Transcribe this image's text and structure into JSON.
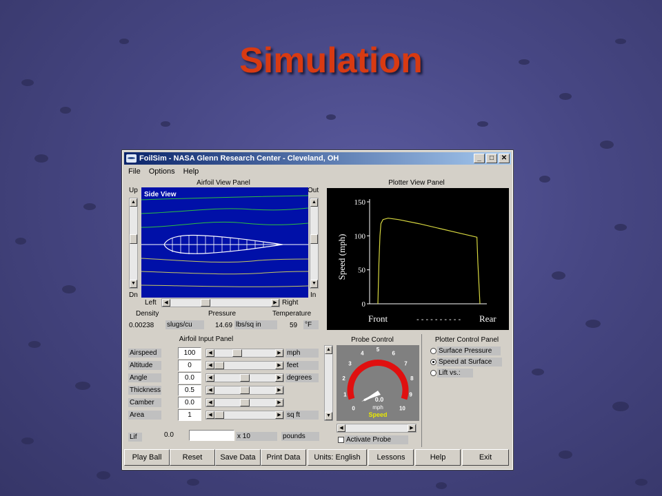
{
  "slide": {
    "title": "Simulation"
  },
  "window": {
    "title": "FoilSim - NASA Glenn Research Center - Cleveland, OH",
    "controls": {
      "minimize": "_",
      "maximize": "□",
      "close": "✕"
    },
    "menu": [
      "File",
      "Options",
      "Help"
    ]
  },
  "airfoil_view": {
    "title": "Airfoil View Panel",
    "side_view": "Side View",
    "up": "Up",
    "dn": "Dn",
    "out": "Out",
    "in": "In",
    "left": "Left",
    "right": "Right",
    "density_label": "Density",
    "pressure_label": "Pressure",
    "temperature_label": "Temperature",
    "density_value": "0.00238",
    "density_unit": "slugs/cu",
    "pressure_value": "14.69",
    "pressure_unit": "lbs/sq in",
    "temperature_value": "59",
    "temperature_unit": "°F",
    "colors": {
      "background": "#0010a8",
      "airfoil": "#ffffff",
      "upper_stream": "#2fbf3f",
      "lower_stream": "#c8c860"
    }
  },
  "airfoil_input": {
    "title": "Airfoil Input Panel",
    "rows": [
      {
        "label": "Airspeed",
        "value": "100",
        "unit": "mph",
        "slider": 0.35
      },
      {
        "label": "Altitude",
        "value": "0",
        "unit": "feet",
        "slider": 0.0
      },
      {
        "label": "Angle",
        "value": "0.0",
        "unit": "degrees",
        "slider": 0.5
      },
      {
        "label": "Thickness",
        "value": "0.5",
        "unit": "",
        "slider": 0.5
      },
      {
        "label": "Camber",
        "value": "0.0",
        "unit": "",
        "slider": 0.5
      },
      {
        "label": "Area",
        "value": "1",
        "unit": "sq ft",
        "slider": 0.0
      }
    ],
    "lift_label": "Lif",
    "lift_value": "0.0",
    "lift_multiplier": "x 10",
    "lift_unit": "pounds"
  },
  "plotter_view": {
    "title": "Plotter View Panel",
    "ylabel": "Speed (mph)",
    "xlabel_front": "Front",
    "xlabel_dashes": "- - - - - - - - - -",
    "xlabel_rear": "Rear"
  },
  "chart_data": {
    "type": "line",
    "title": "",
    "ylabel": "Speed (mph)",
    "xlabel": "Front - - - - - - - - - - Rear",
    "ylim": [
      0,
      150
    ],
    "yticks": [
      "0",
      "50",
      "100",
      "150"
    ],
    "x": [
      0,
      1,
      2,
      3,
      5,
      10,
      20,
      40,
      60,
      80,
      97,
      98,
      100
    ],
    "series": [
      {
        "values": [
          0,
          60,
          100,
          118,
          124,
          126,
          124,
          118,
          111,
          104,
          98,
          60,
          0
        ]
      }
    ],
    "colors": {
      "background": "#000000",
      "axis": "#ffffff",
      "line": "#d8d840"
    }
  },
  "probe_control": {
    "title": "Probe Control",
    "gauge_ticks": [
      "0",
      "1",
      "2",
      "3",
      "4",
      "5",
      "6",
      "7",
      "8",
      "9",
      "10"
    ],
    "gauge_value": "0.0",
    "gauge_unit": "mph",
    "gauge_label": "Speed",
    "activate": "Activate Probe",
    "colors": {
      "gauge_arc": "#e01010",
      "label": "#e8e800"
    }
  },
  "plotter_control": {
    "title": "Plotter Control Panel",
    "options": [
      "Surface Pressure",
      "Speed at Surface",
      "Lift vs.:"
    ],
    "selected": 1
  },
  "buttons": [
    "Play Ball",
    "Reset",
    "Save Data",
    "Print Data",
    "Units: English",
    "Lessons",
    "Help",
    "Exit"
  ]
}
